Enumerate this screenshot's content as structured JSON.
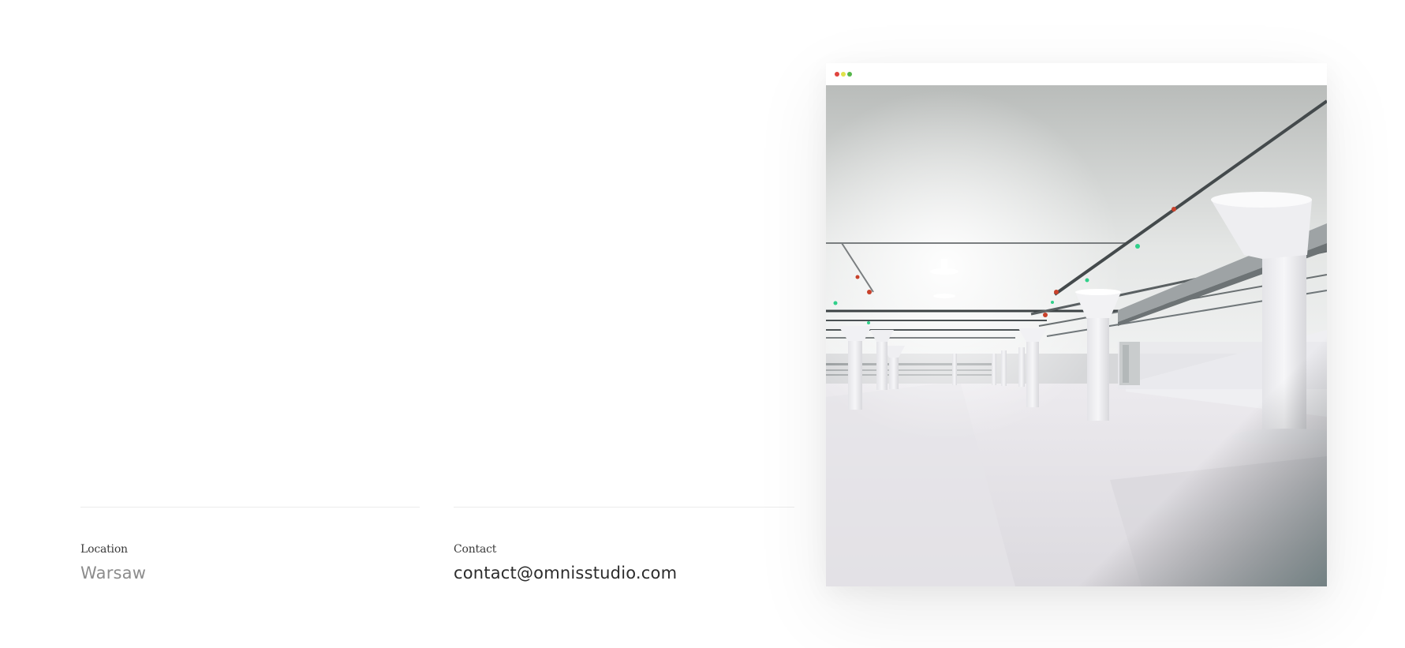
{
  "info": {
    "location": {
      "label": "Location",
      "value": "Warsaw"
    },
    "contact": {
      "label": "Contact",
      "value": "contact@omnisstudio.com"
    }
  },
  "browser_mock": {
    "window_controls": [
      "close-dot",
      "minimize-dot",
      "maximize-dot"
    ],
    "colors": {
      "close": "#e0443e",
      "minimize": "#dfe24a",
      "maximize": "#54b64a"
    }
  }
}
